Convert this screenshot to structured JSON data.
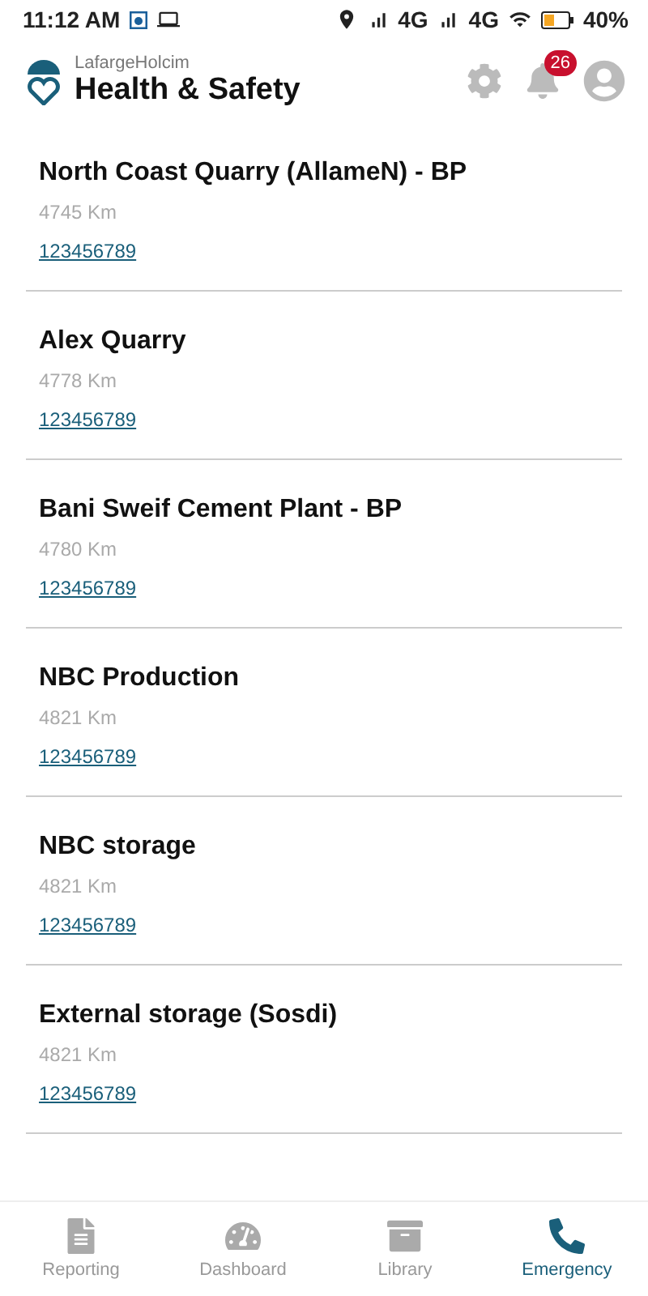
{
  "status_bar": {
    "time": "11:12 AM",
    "network_1": "4G",
    "network_2": "4G",
    "battery": "40%"
  },
  "header": {
    "brand": "LafargeHolcim",
    "title": "Health & Safety",
    "notification_count": "26"
  },
  "sites": [
    {
      "name": "North Coast Quarry (AllameN) - BP",
      "distance": "4745 Km",
      "phone": "123456789"
    },
    {
      "name": "Alex Quarry",
      "distance": "4778 Km",
      "phone": "123456789"
    },
    {
      "name": "Bani Sweif Cement Plant - BP",
      "distance": "4780 Km",
      "phone": "123456789"
    },
    {
      "name": "NBC Production",
      "distance": "4821 Km",
      "phone": "123456789"
    },
    {
      "name": "NBC storage",
      "distance": "4821 Km",
      "phone": "123456789"
    },
    {
      "name": "External storage (Sosdi)",
      "distance": "4821 Km",
      "phone": "123456789"
    }
  ],
  "nav": [
    {
      "kind": "reporting",
      "label": "Reporting",
      "selected": false
    },
    {
      "kind": "dashboard",
      "label": "Dashboard",
      "selected": false
    },
    {
      "kind": "library",
      "label": "Library",
      "selected": false
    },
    {
      "kind": "emergency",
      "label": "Emergency",
      "selected": true
    }
  ]
}
